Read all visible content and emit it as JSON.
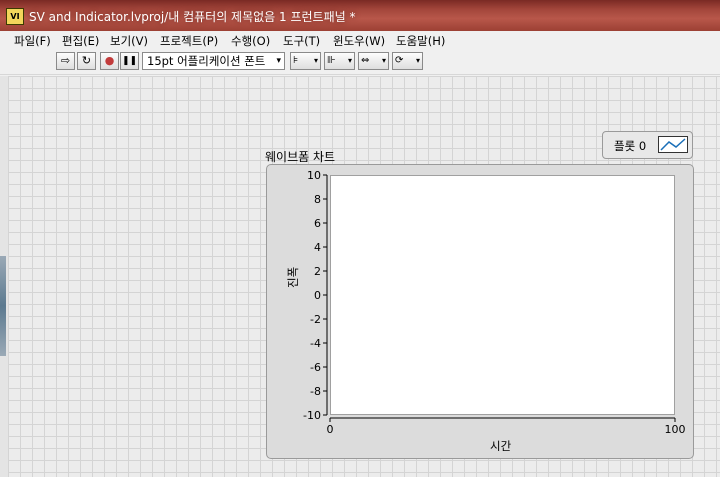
{
  "window": {
    "title": "SV and Indicator.lvproj/내 컴퓨터의 제목없음 1 프런트패널 *",
    "app_icon_text": "VI"
  },
  "menu": [
    "파일(F)",
    "편집(E)",
    "보기(V)",
    "프로젝트(P)",
    "수행(O)",
    "도구(T)",
    "윈도우(W)",
    "도움말(H)"
  ],
  "toolbar": {
    "run": "⇨",
    "run_continuous": "↻",
    "abort": "●",
    "pause": "❚❚",
    "font": "15pt 어플리케이션 폰트",
    "align": "⊧",
    "distribute": "⊪",
    "resize": "⇔",
    "reorder": "⟳"
  },
  "legend": {
    "label": "플롯 0"
  },
  "chart_data": {
    "type": "line",
    "title": "웨이브폼 차트",
    "xlabel": "시간",
    "ylabel": "진폭",
    "xlim": [
      0,
      100
    ],
    "ylim": [
      -10,
      10
    ],
    "x_ticks": [
      "0",
      "100"
    ],
    "y_ticks": [
      "10",
      "8",
      "6",
      "4",
      "2",
      "0",
      "-2",
      "-4",
      "-6",
      "-8",
      "-10"
    ],
    "series": [
      {
        "name": "플롯 0",
        "values": []
      }
    ],
    "grid": false,
    "legend_position": "top-right"
  }
}
